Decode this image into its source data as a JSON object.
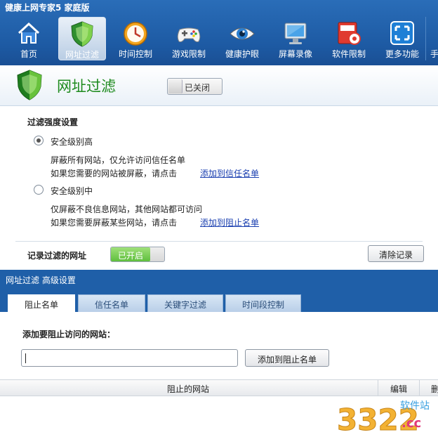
{
  "app": {
    "title": "健康上网专家5 家庭版"
  },
  "toolbar": {
    "items": [
      {
        "label": "首页",
        "icon": "home-icon"
      },
      {
        "label": "网址过滤",
        "icon": "shield-icon",
        "active": true
      },
      {
        "label": "时间控制",
        "icon": "clock-icon"
      },
      {
        "label": "游戏限制",
        "icon": "gamepad-icon"
      },
      {
        "label": "健康护眼",
        "icon": "eye-icon"
      },
      {
        "label": "屏幕录像",
        "icon": "monitor-icon"
      },
      {
        "label": "软件限制",
        "icon": "software-block-icon"
      },
      {
        "label": "更多功能",
        "icon": "more-icon"
      }
    ],
    "overflow_label": "手"
  },
  "header": {
    "title": "网址过滤",
    "toggle_label": "已关闭"
  },
  "strength": {
    "title": "过滤强度设置",
    "high": {
      "label": "安全级别高",
      "desc": "屏蔽所有网站，仅允许访问信任名单",
      "hint": "如果您需要的网站被屏蔽，请点击",
      "link": "添加到信任名单",
      "checked": true
    },
    "mid": {
      "label": "安全级别中",
      "desc": "仅屏蔽不良信息网站，其他网站都可访问",
      "hint": "如果您需要屏蔽某些网站，请点击",
      "link": "添加到阻止名单",
      "checked": false
    }
  },
  "record": {
    "label": "记录过滤的网址",
    "toggle_label": "已开启",
    "clear_button": "清除记录"
  },
  "advanced": {
    "title": "网址过滤 高级设置",
    "tabs": [
      {
        "label": "阻止名单",
        "active": true
      },
      {
        "label": "信任名单"
      },
      {
        "label": "关键字过滤"
      },
      {
        "label": "时间段控制"
      }
    ],
    "add_label": "添加要阻止访问的网站：",
    "input_value": "",
    "add_button": "添加到阻止名单",
    "table": {
      "columns": [
        "阻止的网站",
        "编辑",
        "删"
      ]
    }
  },
  "watermark": {
    "text": "3322",
    "sub": "软件站",
    "domain": ".cc"
  },
  "colors": {
    "toolbar_bg": "#1d5aa3",
    "title_green": "#1d8a1d",
    "link_blue": "#1a3fb0",
    "toggle_on": "#5fbf3d"
  }
}
